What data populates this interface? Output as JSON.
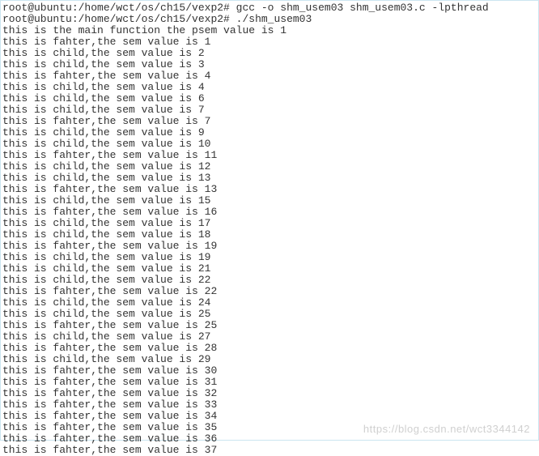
{
  "cmd1": {
    "prompt": "root@ubuntu:/home/wct/os/ch15/vexp2#",
    "command": "gcc -o shm_usem03 shm_usem03.c -lpthread"
  },
  "cmd2": {
    "prompt": "root@ubuntu:/home/wct/os/ch15/vexp2#",
    "command": "./shm_usem03"
  },
  "lines": [
    "this is the main function the psem value is 1",
    "this is fahter,the sem value is 1",
    "this is child,the sem value is 2",
    "this is child,the sem value is 3",
    "this is fahter,the sem value is 4",
    "this is child,the sem value is 4",
    "this is child,the sem value is 6",
    "this is child,the sem value is 7",
    "this is fahter,the sem value is 7",
    "this is child,the sem value is 9",
    "this is child,the sem value is 10",
    "this is fahter,the sem value is 11",
    "this is child,the sem value is 12",
    "this is child,the sem value is 13",
    "this is fahter,the sem value is 13",
    "this is child,the sem value is 15",
    "this is fahter,the sem value is 16",
    "this is child,the sem value is 17",
    "this is child,the sem value is 18",
    "this is fahter,the sem value is 19",
    "this is child,the sem value is 19",
    "this is child,the sem value is 21",
    "this is child,the sem value is 22",
    "this is fahter,the sem value is 22",
    "this is child,the sem value is 24",
    "this is child,the sem value is 25",
    "this is fahter,the sem value is 25",
    "this is child,the sem value is 27",
    "this is fahter,the sem value is 28",
    "this is child,the sem value is 29",
    "this is fahter,the sem value is 30",
    "this is fahter,the sem value is 31",
    "this is fahter,the sem value is 32",
    "this is fahter,the sem value is 33",
    "this is fahter,the sem value is 34",
    "this is fahter,the sem value is 35",
    "this is fahter,the sem value is 36",
    "this is fahter,the sem value is 37"
  ],
  "watermark": "https://blog.csdn.net/wct3344142"
}
